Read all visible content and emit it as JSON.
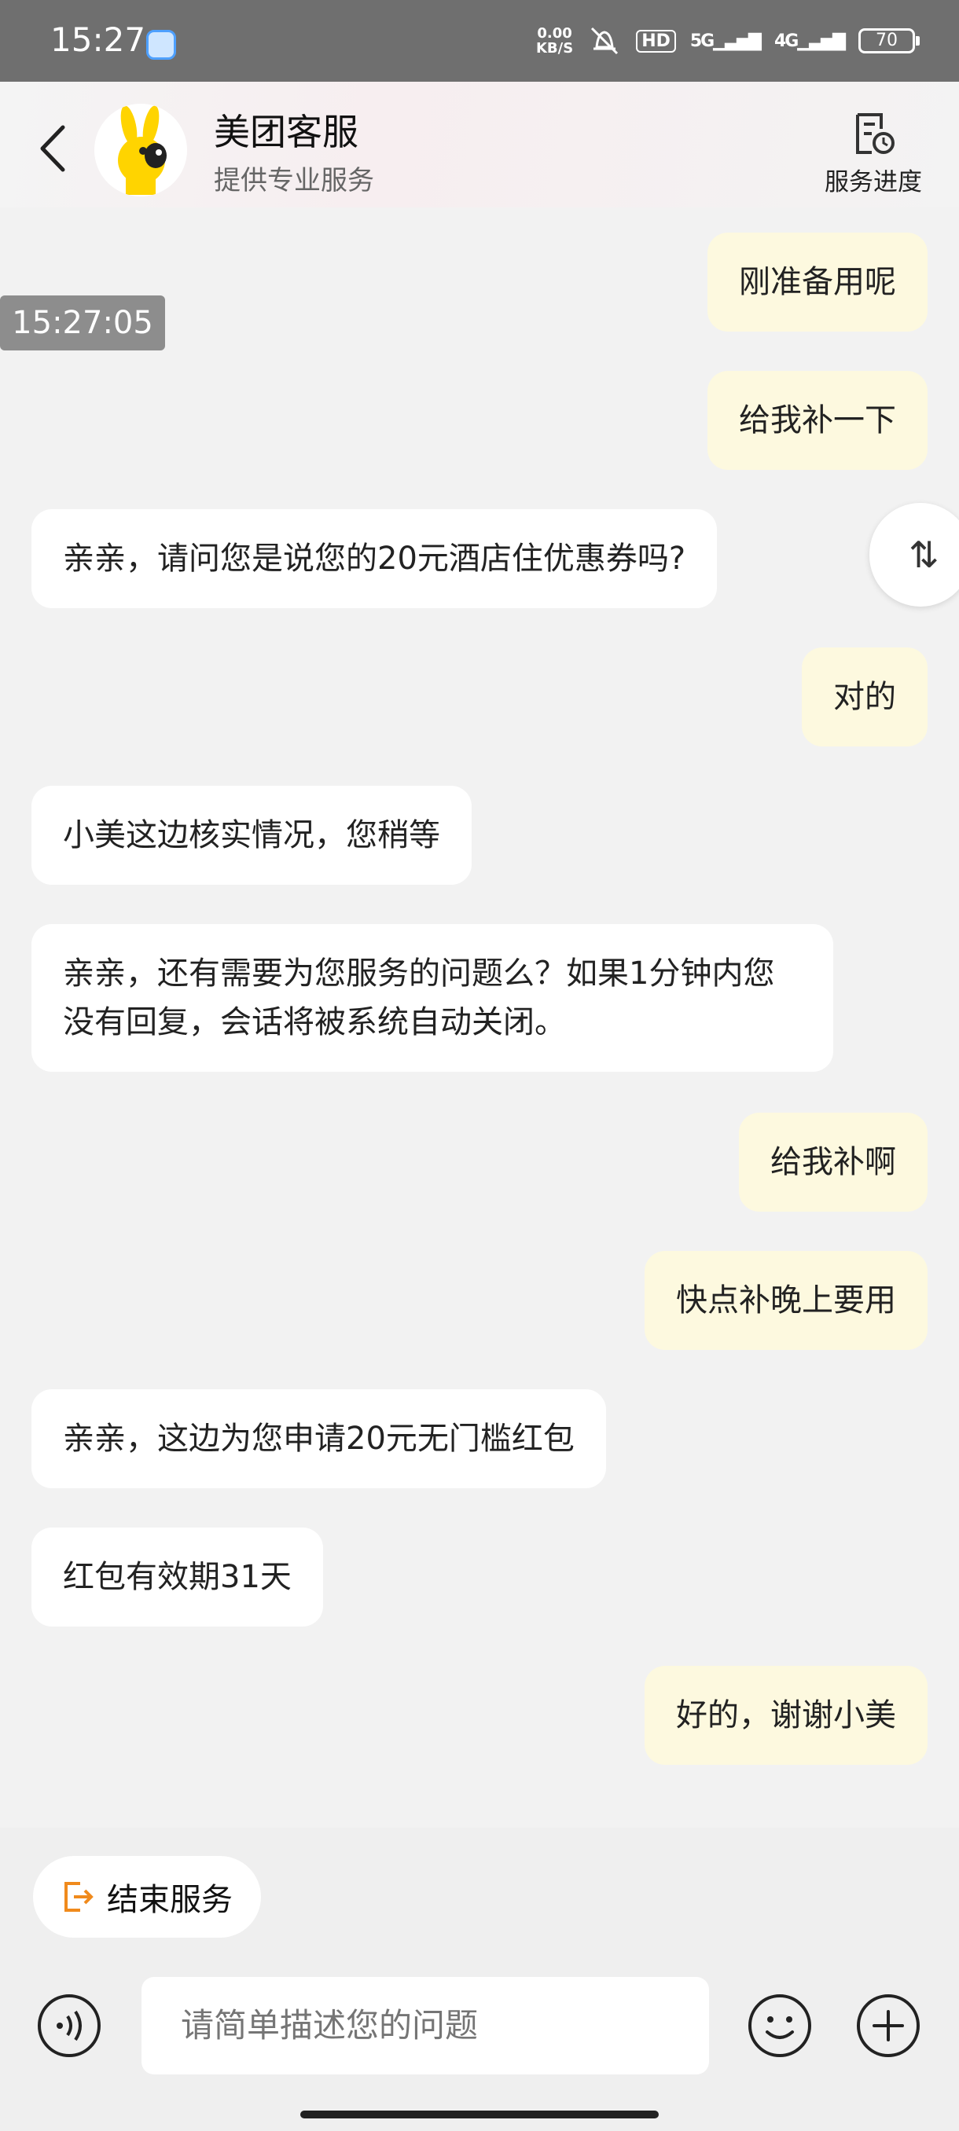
{
  "status_bar": {
    "time": "15:27",
    "net_speed_value": "0.00",
    "net_speed_unit": "KB/S",
    "hd": "HD",
    "signal1": "5G",
    "signal2": "4G",
    "battery": "70"
  },
  "header": {
    "title": "美团客服",
    "subtitle": "提供专业服务",
    "progress_label": "服务进度"
  },
  "timestamp": "15:27:05",
  "messages": [
    {
      "from": "user",
      "text": "刚准备用呢"
    },
    {
      "from": "user",
      "text": "给我补一下"
    },
    {
      "from": "agent",
      "text": "亲亲，请问您是说您的20元酒店住优惠券吗?"
    },
    {
      "from": "user",
      "text": "对的"
    },
    {
      "from": "agent",
      "text": "小美这边核实情况，您稍等"
    },
    {
      "from": "agent",
      "text": "亲亲，还有需要为您服务的问题么？如果1分钟内您没有回复，会话将被系统自动关闭。"
    },
    {
      "from": "user",
      "text": "给我补啊"
    },
    {
      "from": "user",
      "text": "快点补晚上要用"
    },
    {
      "from": "agent",
      "text": "亲亲，这边为您申请20元无门槛红包"
    },
    {
      "from": "agent",
      "text": "红包有效期31天"
    },
    {
      "from": "user",
      "text": "好的，谢谢小美"
    }
  ],
  "scroll_handle_glyph": "⇅",
  "end_service_label": "结束服务",
  "input_placeholder": "请简单描述您的问题",
  "colors": {
    "user_bubble": "#fdf9df",
    "agent_bubble": "#ffffff",
    "end_icon": "#f08a1c",
    "avatar_yellow": "#ffd400"
  }
}
